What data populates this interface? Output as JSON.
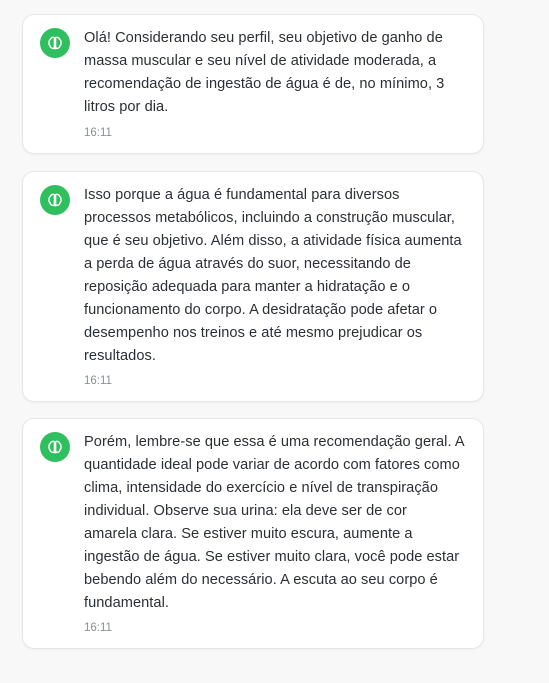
{
  "chat": {
    "messages": [
      {
        "text": "Olá!  Considerando seu perfil, seu objetivo de ganho de\nmassa muscular e seu nível de atividade moderada, a\nrecomendação de ingestão de água é de, no mínimo, 3\nlitros por dia.",
        "time": "16:11",
        "avatar_icon": "brain-icon"
      },
      {
        "text": "Isso porque a água é fundamental para diversos\nprocessos metabólicos, incluindo a construção muscular,\nque é seu objetivo. Além disso, a atividade física aumenta\na perda de água através do suor, necessitando de\nreposição adequada para manter a hidratação e o\nfuncionamento do corpo.  A desidratação pode afetar o\ndesempenho nos treinos e até mesmo prejudicar os\nresultados.",
        "time": "16:11",
        "avatar_icon": "brain-icon"
      },
      {
        "text": "Porém, lembre-se que essa é uma recomendação geral. A\nquantidade ideal pode variar de acordo com fatores como\nclima, intensidade do exercício e nível de transpiração\nindividual.  Observe sua urina: ela deve ser de cor\namarela clara. Se estiver muito escura, aumente a\ningestão de água.  Se estiver muito clara, você pode estar\nbebendo além do necessário.  A escuta ao seu corpo é\nfundamental.",
        "time": "16:11",
        "avatar_icon": "brain-icon"
      }
    ]
  },
  "colors": {
    "avatar_bg": "#2fbf5f",
    "text": "#2b2f36",
    "time": "#8a8f98",
    "card_border": "#e6e6e9",
    "page_bg": "#f8f8f9"
  }
}
